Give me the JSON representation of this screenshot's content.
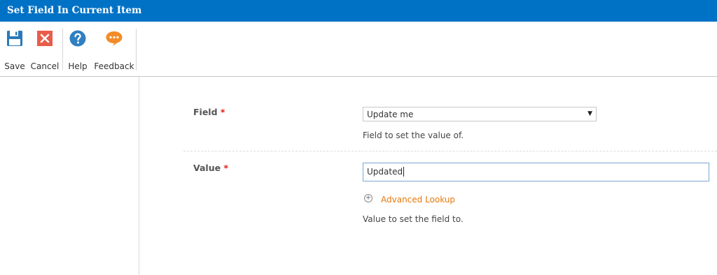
{
  "window": {
    "title": "Set Field In Current Item"
  },
  "ribbon": {
    "save_label": "Save",
    "cancel_label": "Cancel",
    "help_label": "Help",
    "feedback_label": "Feedback",
    "icons": [
      "floppy-disk-icon",
      "close-icon",
      "help-icon",
      "feedback-icon"
    ]
  },
  "colors": {
    "titlebar": "#0072c6",
    "link": "#e8780a",
    "required": "#e41b17"
  },
  "form": {
    "field": {
      "label": "Field",
      "required_marker": "*",
      "selected_value": "Update me",
      "description": "Field to set the value of."
    },
    "value": {
      "label": "Value",
      "required_marker": "*",
      "input_value": "Updated",
      "advanced_lookup_label": "Advanced Lookup",
      "description": "Value to set the field to."
    }
  }
}
